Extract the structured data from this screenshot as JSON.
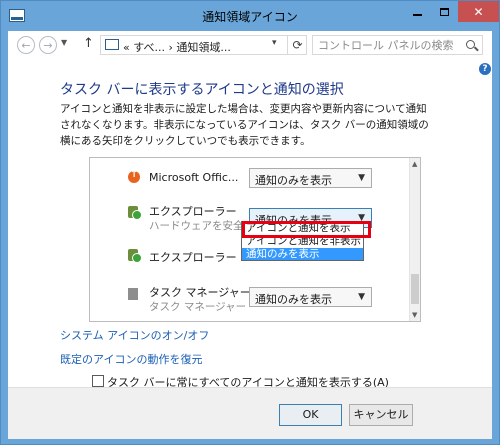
{
  "window": {
    "title": "通知領域アイコン"
  },
  "nav": {
    "back_glyph": "←",
    "forward_glyph": "→",
    "up_glyph": "↑",
    "breadcrumb": "« すべ... › 通知領域...",
    "refresh_glyph": "⟳",
    "search_placeholder": "コントロール パネルの検索"
  },
  "page": {
    "heading": "タスク バーに表示するアイコンと通知の選択",
    "description": "アイコンと通知を非表示に設定した場合は、変更内容や更新内容について通知されなくなります。非表示になっているアイコンは、タスク バーの通知領域の横にある矢印をクリックしていつでも表示できます。"
  },
  "icons_list": [
    {
      "name": "Microsoft Offic...",
      "sub": "",
      "behavior": "通知のみを表示",
      "icon": "office-upload-icon"
    },
    {
      "name": "エクスプローラー",
      "sub": "ハードウェアを安全...",
      "behavior": "通知のみを表示",
      "icon": "usb-eject-icon"
    },
    {
      "name": "エクスプローラー",
      "sub": "",
      "behavior": "",
      "icon": "usb-eject-icon"
    },
    {
      "name": "タスク マネージャー",
      "sub": "タスク マネージャー",
      "behavior": "通知のみを表示",
      "icon": "task-manager-icon"
    }
  ],
  "dropdown_options": [
    "アイコンと通知を表示",
    "アイコンと通知を非表示",
    "通知のみを表示"
  ],
  "dropdown_selected_index": 2,
  "links": {
    "system_icons": "システム アイコンのオン/オフ",
    "restore_defaults": "既定のアイコンの動作を復元"
  },
  "always_show": {
    "label": "タスク バーに常にすべてのアイコンと通知を表示する(A)",
    "checked": false
  },
  "buttons": {
    "ok": "OK",
    "cancel": "キャンセル"
  },
  "colors": {
    "titlebar": "#6aa5d9",
    "close": "#c75050",
    "highlight_box": "#e60012",
    "selected_option": "#3399ff",
    "heading": "#1e3a8a"
  }
}
